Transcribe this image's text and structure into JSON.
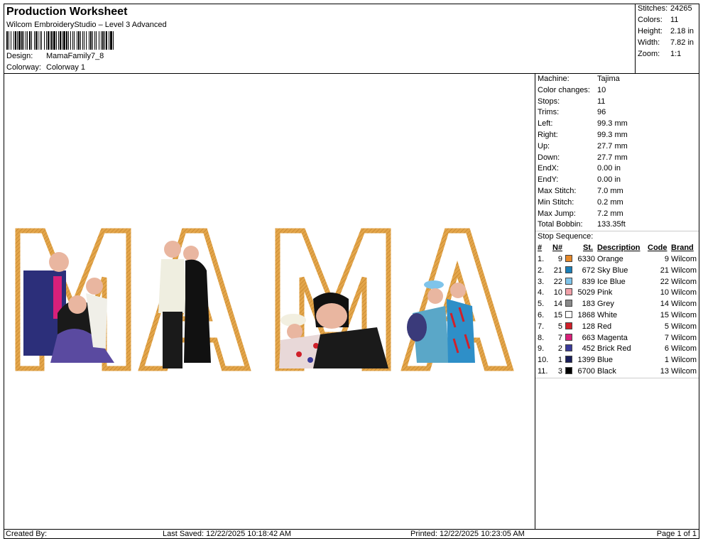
{
  "header": {
    "title": "Production Worksheet",
    "subtitle": "Wilcom EmbroideryStudio – Level 3 Advanced",
    "design_label": "Design:",
    "design_value": "MamaFamily7_8",
    "colorway_label": "Colorway:",
    "colorway_value": "Colorway 1"
  },
  "stats": {
    "stitches_label": "Stitches:",
    "stitches": "24265",
    "colors_label": "Colors:",
    "colors": "11",
    "height_label": "Height:",
    "height": "2.18 in",
    "width_label": "Width:",
    "width": "7.82 in",
    "zoom_label": "Zoom:",
    "zoom": "1:1"
  },
  "machine": [
    {
      "k": "Machine:",
      "v": "Tajima"
    },
    {
      "k": "Color changes:",
      "v": "10"
    },
    {
      "k": "Stops:",
      "v": "11"
    },
    {
      "k": "Trims:",
      "v": "96"
    },
    {
      "k": "Left:",
      "v": "99.3 mm"
    },
    {
      "k": "Right:",
      "v": "99.3 mm"
    },
    {
      "k": "Up:",
      "v": "27.7 mm"
    },
    {
      "k": "Down:",
      "v": "27.7 mm"
    },
    {
      "k": "EndX:",
      "v": "0.00 in"
    },
    {
      "k": "EndY:",
      "v": "0.00 in"
    },
    {
      "k": "Max Stitch:",
      "v": "7.0 mm"
    },
    {
      "k": "Min Stitch:",
      "v": "0.2 mm"
    },
    {
      "k": "Max Jump:",
      "v": "7.2 mm"
    },
    {
      "k": "Total Bobbin:",
      "v": "133.35ft"
    }
  ],
  "stop_sequence": {
    "title": "Stop Sequence:",
    "headers": {
      "num": "#",
      "n": "N#",
      "st": "St.",
      "desc": "Description",
      "code": "Code",
      "brand": "Brand"
    },
    "rows": [
      {
        "num": "1.",
        "n": "9",
        "color": "#e6892a",
        "st": "6330",
        "desc": "Orange",
        "code": "9",
        "brand": "Wilcom"
      },
      {
        "num": "2.",
        "n": "21",
        "color": "#1b7fb8",
        "st": "672",
        "desc": "Sky Blue",
        "code": "21",
        "brand": "Wilcom"
      },
      {
        "num": "3.",
        "n": "22",
        "color": "#7fc4ea",
        "st": "839",
        "desc": "Ice Blue",
        "code": "22",
        "brand": "Wilcom"
      },
      {
        "num": "4.",
        "n": "10",
        "color": "#f0a0a8",
        "st": "5029",
        "desc": "Pink",
        "code": "10",
        "brand": "Wilcom"
      },
      {
        "num": "5.",
        "n": "14",
        "color": "#8a8a8a",
        "st": "183",
        "desc": "Grey",
        "code": "14",
        "brand": "Wilcom"
      },
      {
        "num": "6.",
        "n": "15",
        "color": "#ffffff",
        "st": "1868",
        "desc": "White",
        "code": "15",
        "brand": "Wilcom"
      },
      {
        "num": "7.",
        "n": "5",
        "color": "#d0202a",
        "st": "128",
        "desc": "Red",
        "code": "5",
        "brand": "Wilcom"
      },
      {
        "num": "8.",
        "n": "7",
        "color": "#d8207a",
        "st": "663",
        "desc": "Magenta",
        "code": "7",
        "brand": "Wilcom"
      },
      {
        "num": "9.",
        "n": "2",
        "color": "#3a3a9a",
        "st": "452",
        "desc": "Brick Red",
        "code": "6",
        "brand": "Wilcom"
      },
      {
        "num": "10.",
        "n": "1",
        "color": "#1a1f5a",
        "st": "1399",
        "desc": "Blue",
        "code": "1",
        "brand": "Wilcom"
      },
      {
        "num": "11.",
        "n": "3",
        "color": "#000000",
        "st": "6700",
        "desc": "Black",
        "code": "13",
        "brand": "Wilcom"
      }
    ]
  },
  "design_preview": {
    "letters": "MAMA",
    "outline_color": "#e3a54a",
    "fill_color": "#ffffff"
  },
  "footer": {
    "created_by": "Created By:",
    "last_saved": "Last Saved: 12/22/2025 10:18:42 AM",
    "printed": "Printed: 12/22/2025 10:23:05 AM",
    "page": "Page 1 of 1"
  }
}
